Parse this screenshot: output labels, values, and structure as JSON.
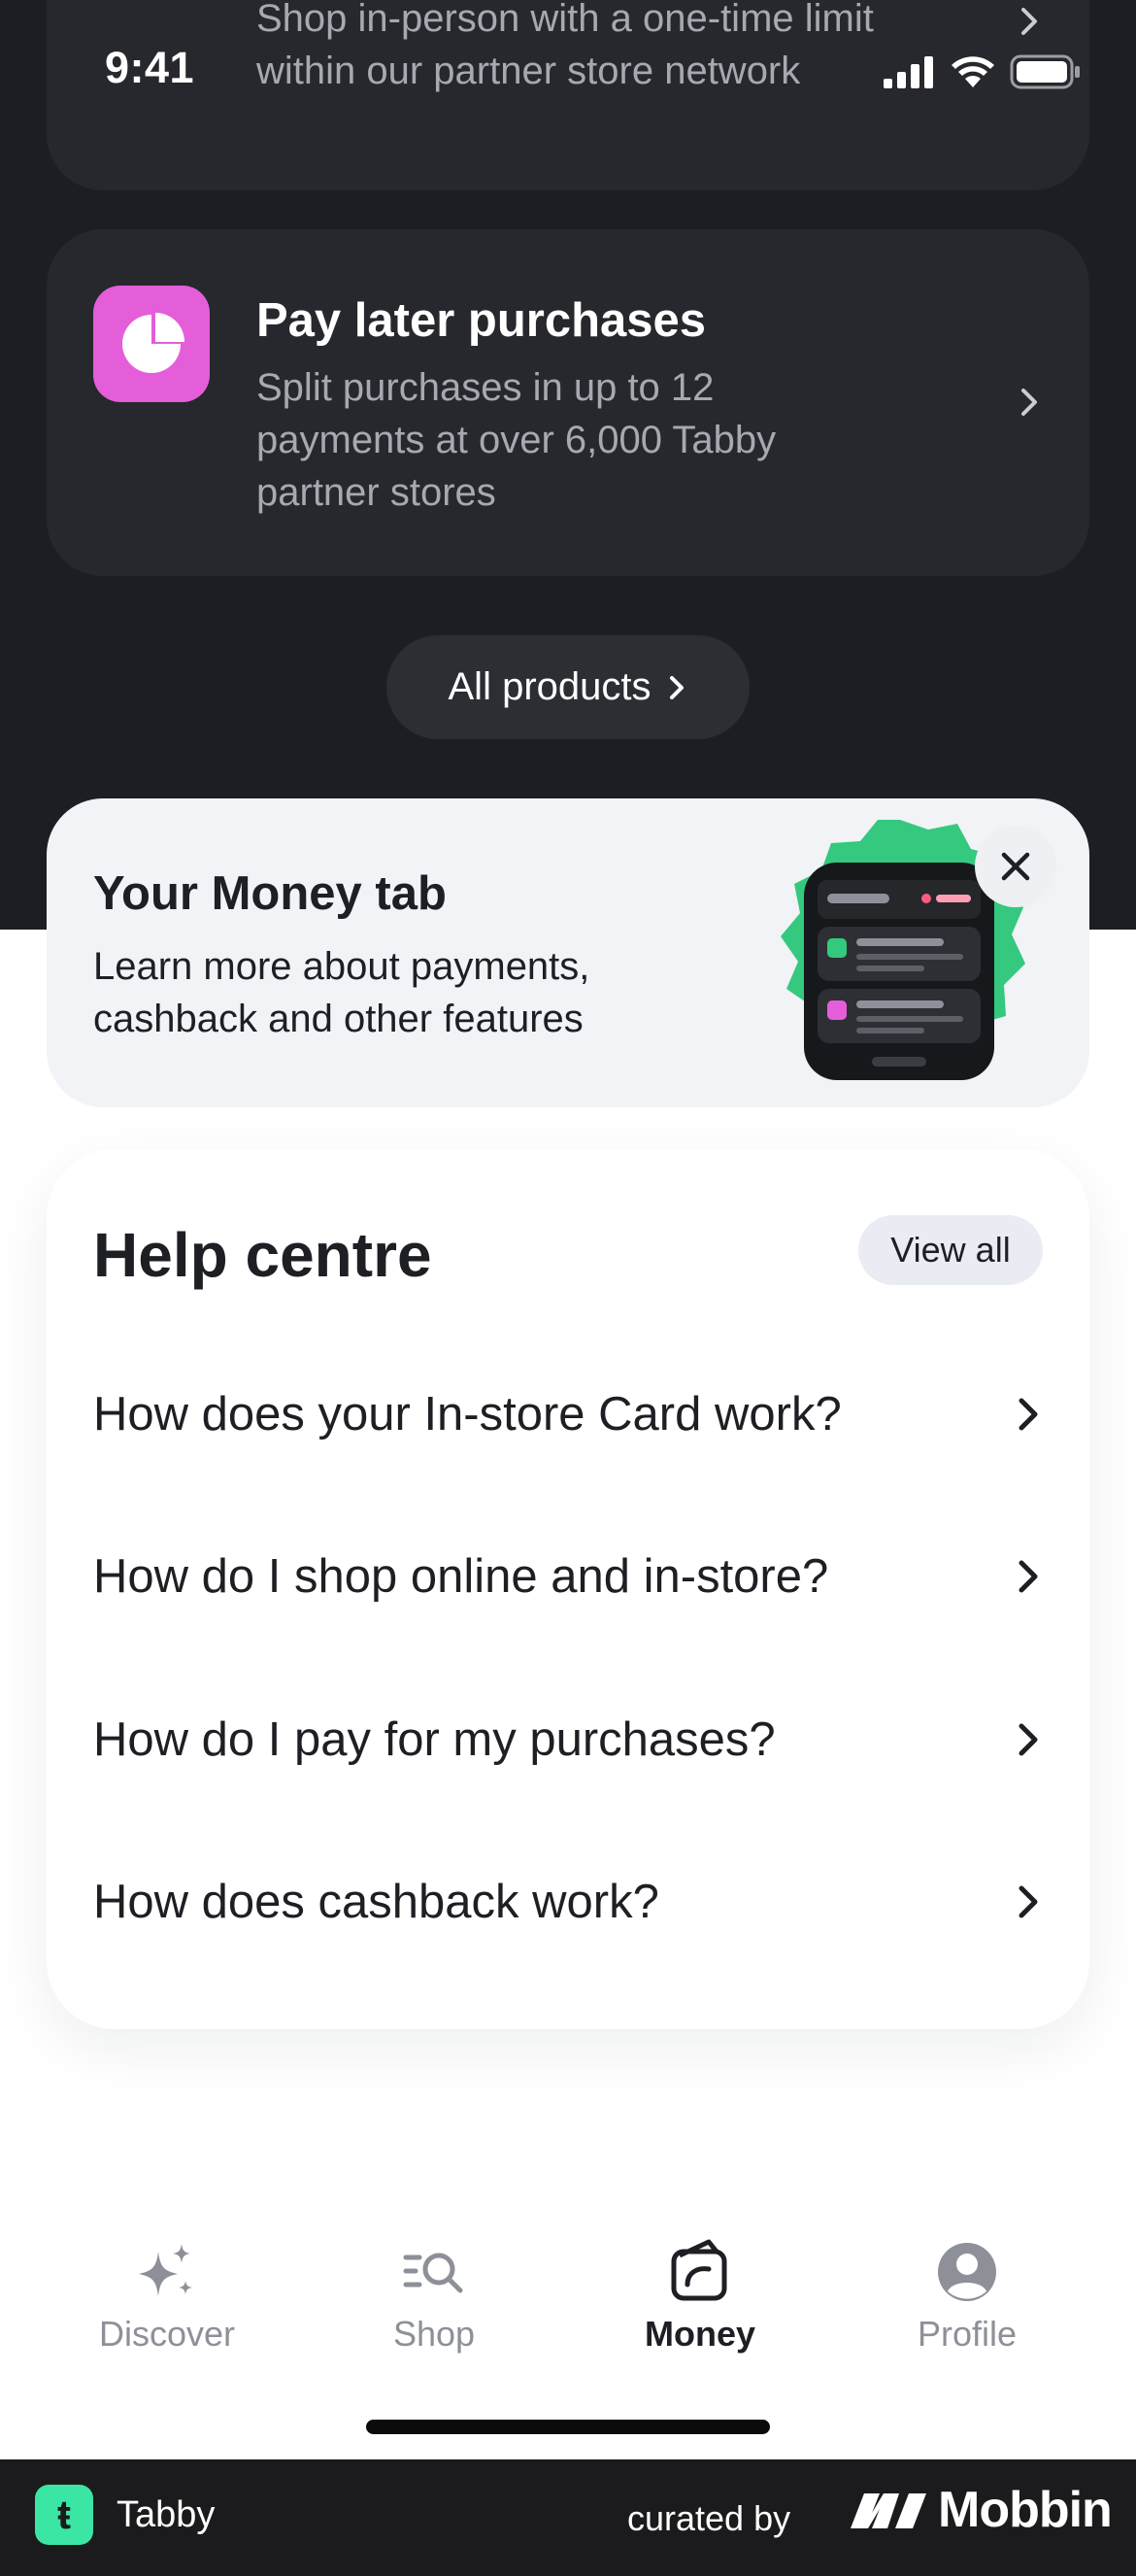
{
  "status_bar": {
    "time": "9:41"
  },
  "products": [
    {
      "title": "",
      "description": "Shop in-person with a one-time limit within our partner store network",
      "icon": "card-icon",
      "accent": "#35d07f"
    },
    {
      "title": "Pay later purchases",
      "description": "Split purchases in up to 12 payments at over 6,000 Tabby partner stores",
      "icon": "pie-chart-icon",
      "accent": "#e55ed9"
    }
  ],
  "all_products_label": "All products",
  "money_banner": {
    "title": "Your Money tab",
    "description": "Learn more about payments, cashback and other features"
  },
  "help_centre": {
    "title": "Help centre",
    "view_all_label": "View all",
    "items": [
      {
        "label": "How does your In-store Card work?"
      },
      {
        "label": "How do I shop online and in-store?"
      },
      {
        "label": "How do I pay for my purchases?"
      },
      {
        "label": "How does cashback work?"
      }
    ]
  },
  "tabbar": {
    "tabs": [
      {
        "label": "Discover",
        "icon": "sparkle-icon",
        "active": false
      },
      {
        "label": "Shop",
        "icon": "search-list-icon",
        "active": false
      },
      {
        "label": "Money",
        "icon": "wallet-icon",
        "active": true
      },
      {
        "label": "Profile",
        "icon": "user-icon",
        "active": false
      }
    ]
  },
  "footer": {
    "app_name": "Tabby",
    "logo_letter": "ŧ",
    "curated_by": "curated by",
    "brand": "Mobbin"
  },
  "colors": {
    "dark_bg": "#1c1e23",
    "card_bg": "#26282d",
    "brand_green": "#3be5a4",
    "pink": "#e55ed9"
  }
}
